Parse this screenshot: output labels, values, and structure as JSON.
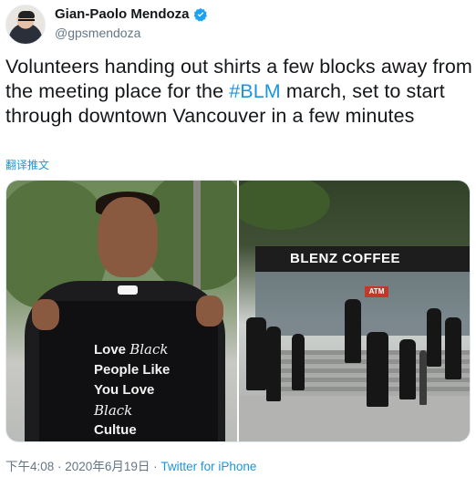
{
  "author": {
    "display_name": "Gian-Paolo Mendoza",
    "handle": "@gpsmendoza",
    "verified_color": "#1da1f2"
  },
  "tweet": {
    "text_before": "Volunteers handing out shirts a few blocks away from the meeting place for the ",
    "hashtag": "#BLM",
    "text_after": " march, set to start through downtown Vancouver in a few minutes",
    "translate_label": "翻译推文"
  },
  "media": {
    "left_photo": {
      "shirt_lines": [
        "Love",
        "Black",
        "People Like",
        "You Love",
        "Black",
        "Cultue"
      ]
    },
    "right_photo": {
      "storefront_sign": "BLENZ COFFEE",
      "atm_sign": "ATM"
    }
  },
  "footer": {
    "time": "下午4:08",
    "separator1": " · ",
    "date": "2020年6月19日",
    "separator2": " · ",
    "source": "Twitter for iPhone"
  },
  "colors": {
    "link": "#1b95e0",
    "text": "#14171a",
    "secondary": "#657786"
  }
}
